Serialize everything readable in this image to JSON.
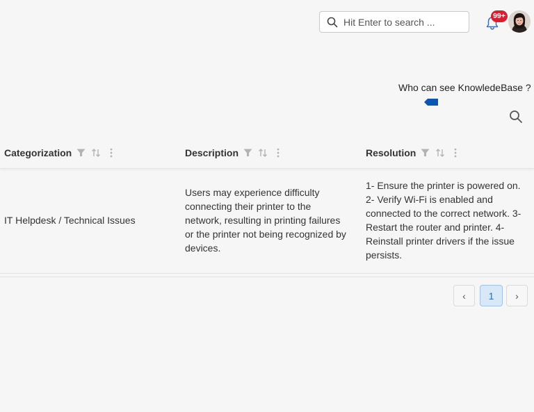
{
  "header": {
    "search": {
      "placeholder": "Hit Enter to search ...",
      "value": ""
    },
    "notifications": {
      "badge": "99+",
      "badge_color": "#d71f2f"
    },
    "icons": {
      "search": "search-icon",
      "bell": "bell-icon",
      "avatar": "user-avatar"
    }
  },
  "knowledge_base": {
    "visibility_label": "Who can see KnowledeBase ?",
    "visibility_color": "#0b56b3"
  },
  "table": {
    "columns": [
      {
        "label": "Categorization"
      },
      {
        "label": "Description"
      },
      {
        "label": "Resolution"
      }
    ],
    "rows": [
      {
        "categorization": "IT Helpdesk / Technical Issues",
        "description": "Users may experience difficulty connecting their printer to the network, resulting in printing failures or the printer not being recognized by devices.",
        "resolution": "1- Ensure the printer is powered on. 2- Verify Wi-Fi is enabled and connected to the correct network. 3- Restart the router and printer. 4- Reinstall printer drivers if the issue persists."
      }
    ]
  },
  "pagination": {
    "prev": "‹",
    "current_page": "1",
    "next": "›",
    "accent": "#2a6db0"
  }
}
